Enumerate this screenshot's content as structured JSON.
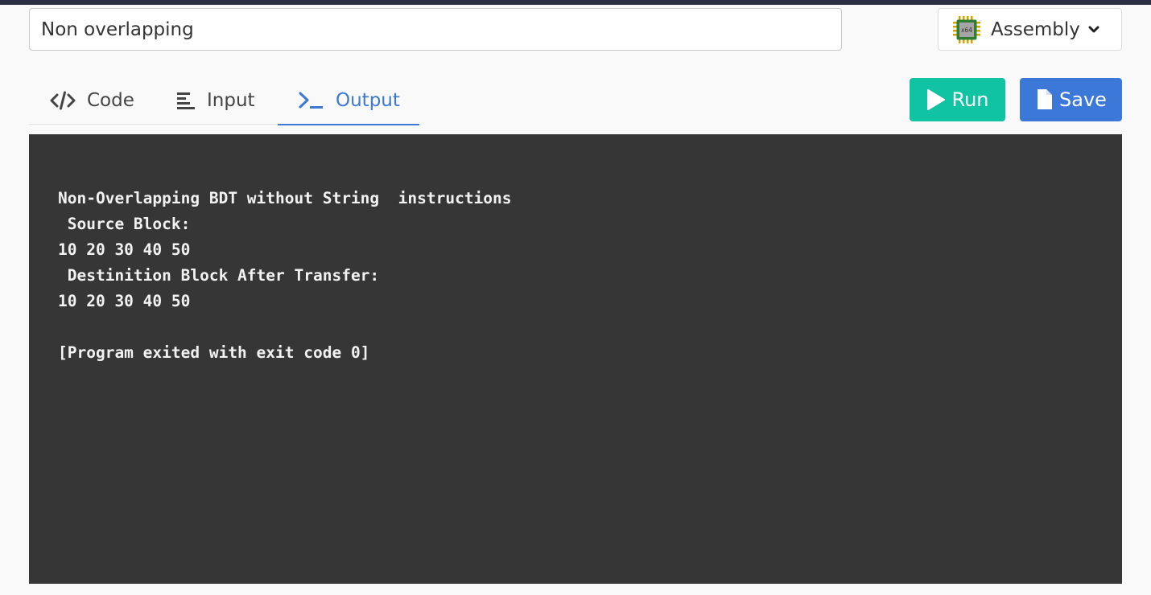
{
  "title_input": {
    "value": "Non overlapping"
  },
  "language": {
    "label": "Assembly",
    "icon": "x64-chip-icon",
    "icon_text": "x64"
  },
  "tabs": [
    {
      "label": "Code",
      "icon": "code-icon"
    },
    {
      "label": "Input",
      "icon": "align-left-icon"
    },
    {
      "label": "Output",
      "icon": "terminal-icon",
      "active": true
    }
  ],
  "buttons": {
    "run_label": "Run",
    "save_label": "Save"
  },
  "colors": {
    "accent": "#3b78d8",
    "run": "#10c3a3",
    "console_bg": "#363636"
  },
  "output": {
    "lines": [
      "Non-Overlapping BDT without String  instructions",
      " Source Block:",
      "10 20 30 40 50",
      " Destinition Block After Transfer:",
      "10 20 30 40 50",
      "",
      "[Program exited with exit code 0]"
    ]
  }
}
